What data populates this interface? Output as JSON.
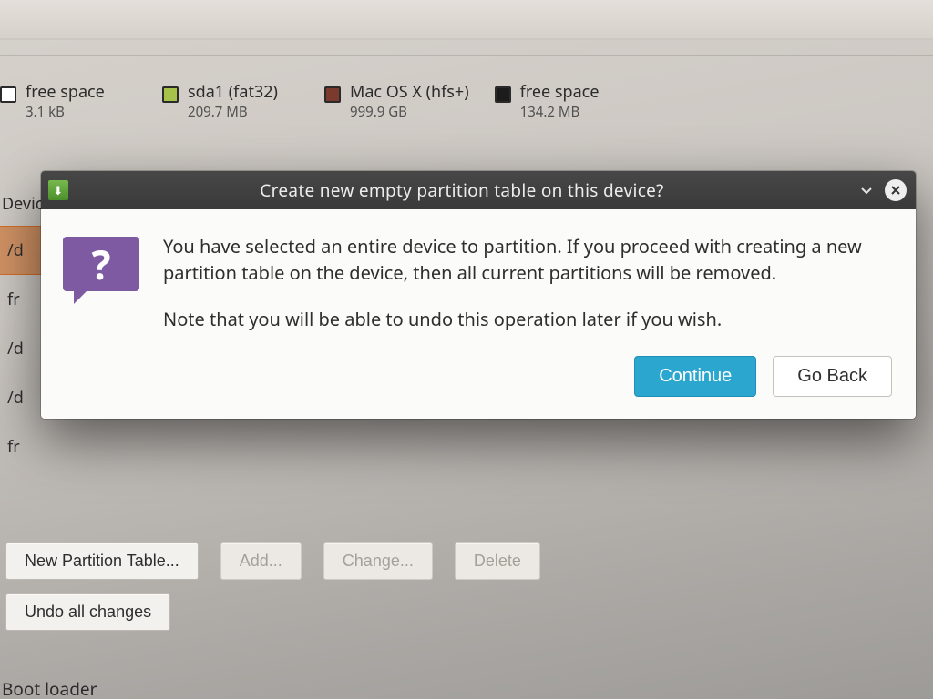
{
  "toolbar": {},
  "legend": {
    "items": [
      {
        "label": "free space",
        "size": "3.1 kB",
        "color": "#ffffff"
      },
      {
        "label": "sda1 (fat32)",
        "size": "209.7 MB",
        "color": "#a7c24a"
      },
      {
        "label": "Mac OS X (hfs+)",
        "size": "999.9 GB",
        "color": "#7a3b2e"
      },
      {
        "label": "free space",
        "size": "134.2 MB",
        "color": "#1c1c1c"
      }
    ]
  },
  "device_tree": {
    "header": "Devic",
    "rows": [
      {
        "label": "/d",
        "selected": true
      },
      {
        "label": "fr"
      },
      {
        "label": "/d"
      },
      {
        "label": "/d"
      },
      {
        "label": "fr"
      }
    ]
  },
  "bottom_buttons": {
    "new_table": "New Partition Table...",
    "add": "Add...",
    "change": "Change...",
    "delete": "Delete",
    "undo": "Undo all changes"
  },
  "boot_loader_label": "Boot loader",
  "dialog": {
    "title": "Create new empty partition table on this device?",
    "para1": "You have selected an entire device to partition. If you proceed with creating a new partition table on the device, then all current partitions will be removed.",
    "para2": "Note that you will be able to undo this operation later if you wish.",
    "continue": "Continue",
    "go_back": "Go Back"
  }
}
